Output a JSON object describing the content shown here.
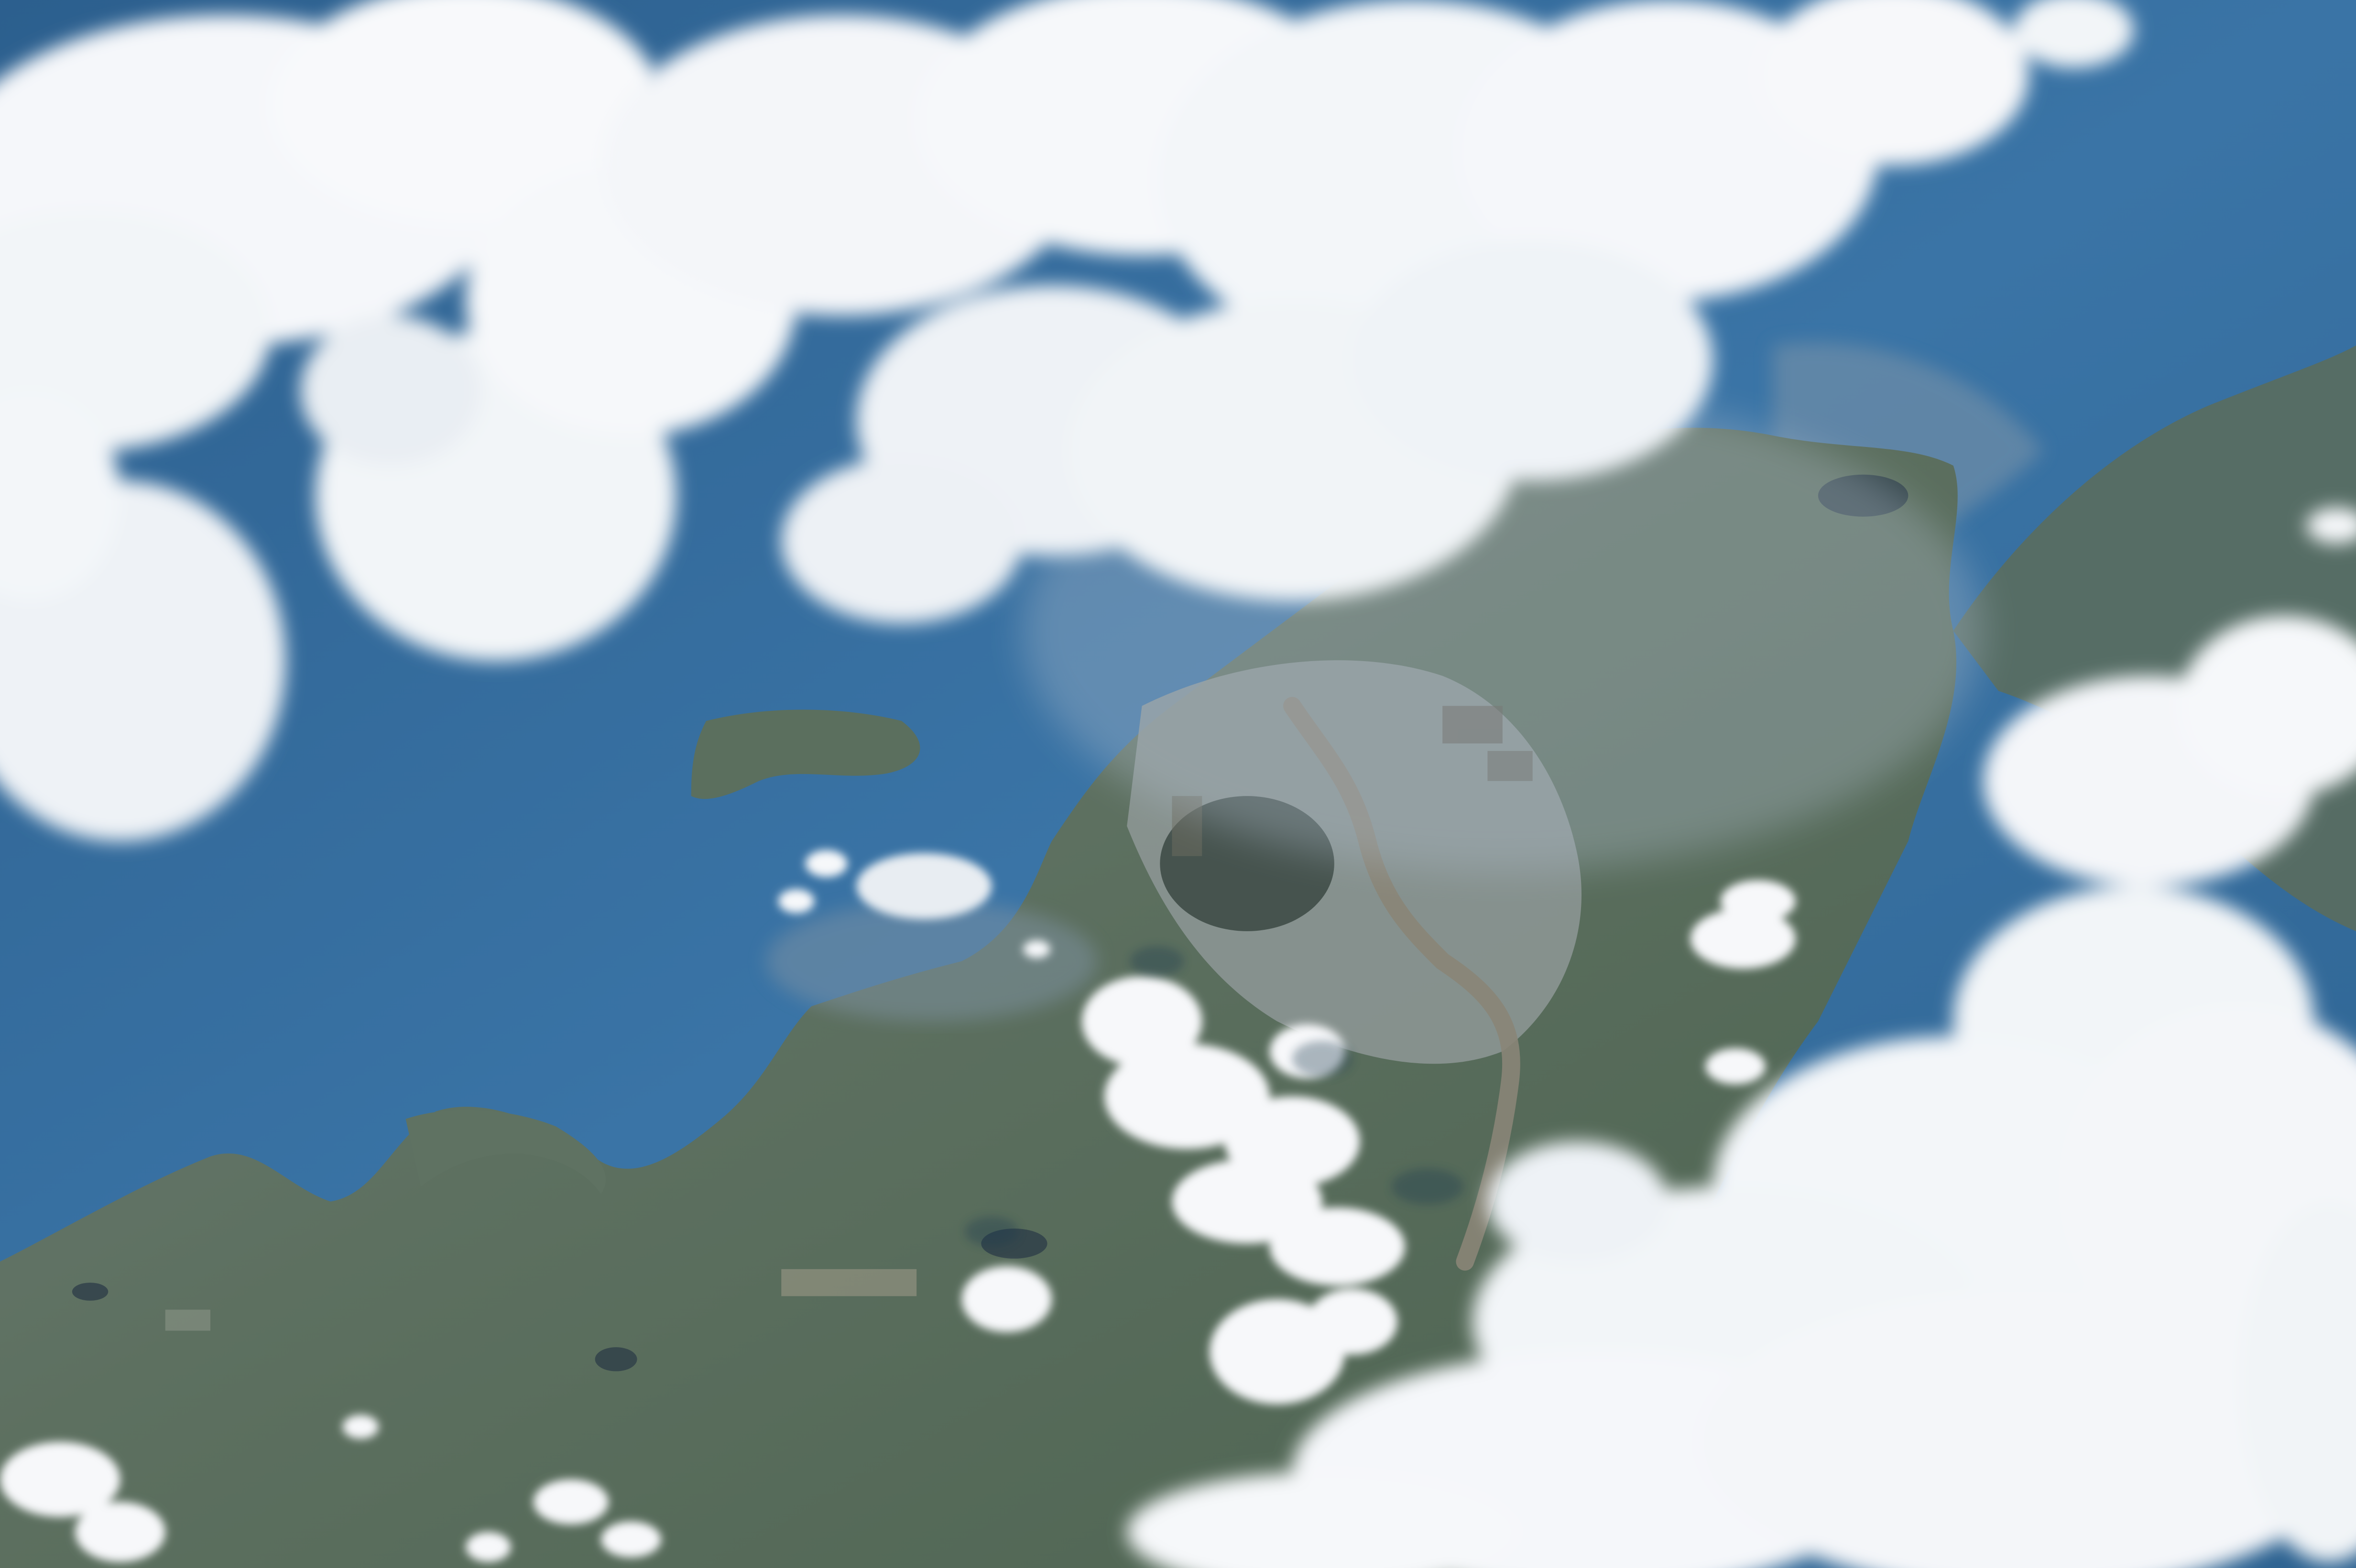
{
  "photo": {
    "subject": "",
    "caption": ""
  },
  "palette": {
    "ocean_deep": "#2f6493",
    "ocean_mid": "#3b75a6",
    "ocean_light": "#5f8fb8",
    "sediment": "#8a9296",
    "land_green": "#4e6a52",
    "land_grey": "#7f8a88",
    "urban": "#9aa2a4",
    "river": "#7d7a6f",
    "cloud_white": "#f7f8fa",
    "cloud_shadow": "#c8d2dc",
    "haze": "#b9c6d0"
  }
}
